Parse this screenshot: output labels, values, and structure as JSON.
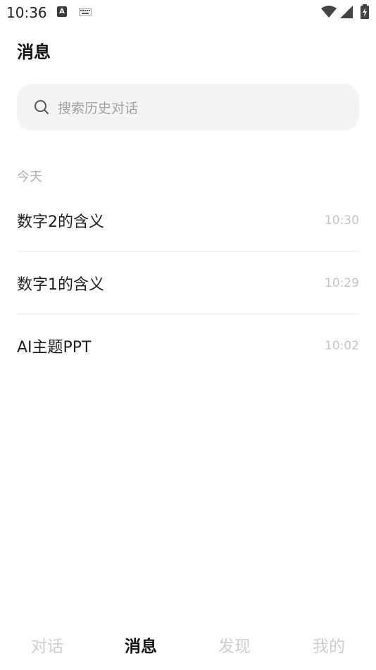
{
  "status_bar": {
    "time": "10:36",
    "icons": [
      "a-notification-icon",
      "keyboard-icon",
      "wifi-icon",
      "signal-icon",
      "battery-icon"
    ]
  },
  "header": {
    "title": "消息"
  },
  "search": {
    "placeholder": "搜索历史对话"
  },
  "sections": [
    {
      "label": "今天",
      "items": [
        {
          "title": "数字2的含义",
          "time": "10:30"
        },
        {
          "title": "数字1的含义",
          "time": "10:29"
        },
        {
          "title": "AI主题PPT",
          "time": "10:02"
        }
      ]
    }
  ],
  "bottom_nav": {
    "tabs": [
      {
        "label": "对话",
        "active": false
      },
      {
        "label": "消息",
        "active": true
      },
      {
        "label": "发现",
        "active": false
      },
      {
        "label": "我的",
        "active": false
      }
    ]
  },
  "colors": {
    "active_text": "#111111",
    "inactive_text": "#cfcfcf",
    "search_bg": "#f4f4f4",
    "muted": "#c4c4c4"
  }
}
